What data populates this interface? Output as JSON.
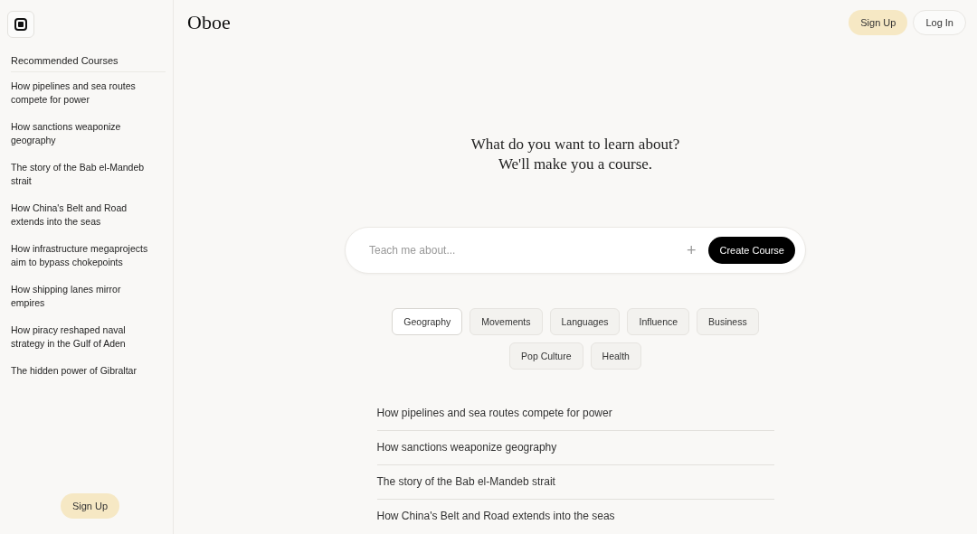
{
  "sidebar": {
    "title": "Recommended Courses",
    "items": [
      "How pipelines and sea routes compete for power",
      "How sanctions weaponize geography",
      "The story of the Bab el-Mandeb strait",
      "How China's Belt and Road extends into the seas",
      "How infrastructure megaprojects aim to bypass chokepoints",
      "How shipping lanes mirror empires",
      "How piracy reshaped naval strategy in the Gulf of Aden",
      "The hidden power of Gibraltar"
    ],
    "button": "Sign Up"
  },
  "header": {
    "logo": "Oboe",
    "buttons": [
      {
        "label": "Sign Up",
        "kind": "primary"
      },
      {
        "label": "Log In",
        "kind": "secondary"
      }
    ]
  },
  "headline": [
    "What do you want to learn about?",
    "We'll make you a course."
  ],
  "search": {
    "placeholder": "Teach me about...",
    "add": "+",
    "button": "Create Course"
  },
  "categories": [
    {
      "label": "Geography",
      "selected": true
    },
    {
      "label": "Movements",
      "selected": false
    },
    {
      "label": "Languages",
      "selected": false
    },
    {
      "label": "Influence",
      "selected": false
    },
    {
      "label": "Business",
      "selected": false
    },
    {
      "label": "Pop Culture",
      "selected": false
    },
    {
      "label": "Health",
      "selected": false
    }
  ],
  "courses": [
    "How pipelines and sea routes compete for power",
    "How sanctions weaponize geography",
    "The story of the Bab el-Mandeb strait",
    "How China's Belt and Road extends into the seas"
  ]
}
